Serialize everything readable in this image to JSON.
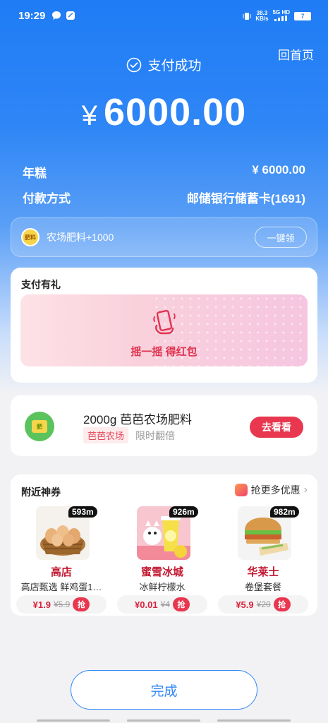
{
  "status_bar": {
    "time": "19:29",
    "net_speed": "38.3",
    "net_unit": "KB/s",
    "signal": "5G HD",
    "battery": "7"
  },
  "header": {
    "home_link": "回首页",
    "success_text": "支付成功",
    "currency": "¥",
    "amount": "6000.00"
  },
  "details": {
    "item_label": "年糕",
    "item_value": "¥ 6000.00",
    "method_label": "付款方式",
    "method_value": "邮储银行储蓄卡(1691)"
  },
  "reward": {
    "badge": "肥料",
    "text": "农场肥料+1000",
    "button": "一键领"
  },
  "gift": {
    "title": "支付有礼",
    "shake_text": "摇一摇 得红包"
  },
  "farm": {
    "title": "2000g 芭芭农场肥料",
    "tag": "芭芭农场",
    "sub": "限时翻倍",
    "button": "去看看",
    "logo_text": "肥"
  },
  "coupons": {
    "title": "附近神券",
    "more": "抢更多优惠",
    "items": [
      {
        "distance": "593m",
        "name": "高店",
        "desc": "高店甄选     鲜鸡蛋1…",
        "price": "¥1.9",
        "old_price": "¥5.9",
        "grab": "抢"
      },
      {
        "distance": "926m",
        "name": "蜜雪冰城",
        "desc": "冰鲜柠檬水",
        "price": "¥0.01",
        "old_price": "¥4",
        "grab": "抢"
      },
      {
        "distance": "982m",
        "name": "华莱士",
        "desc": "卷堡套餐",
        "price": "¥5.9",
        "old_price": "¥20",
        "grab": "抢"
      }
    ]
  },
  "footer": {
    "done": "完成"
  },
  "colors": {
    "primary": "#2f86f6",
    "accent_red": "#e8374f"
  }
}
